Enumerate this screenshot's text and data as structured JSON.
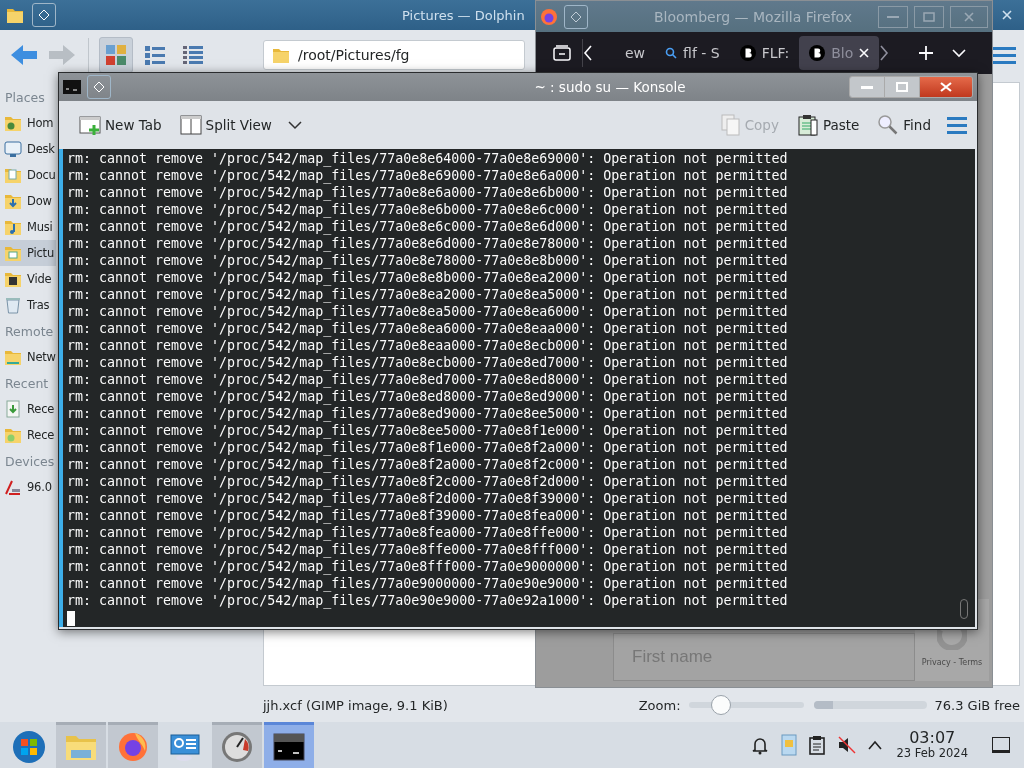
{
  "dolphin": {
    "title": "Pictures — Dolphin",
    "location": "/root/Pictures/fg",
    "view_modes": [
      {
        "kind": "icons",
        "selected": true
      },
      {
        "kind": "compact",
        "selected": false
      },
      {
        "kind": "details",
        "selected": false
      }
    ],
    "sidebar": [
      {
        "heading": "Places",
        "items": [
          {
            "kind": "home",
            "label": "Hom",
            "selected": false
          },
          {
            "kind": "desktop",
            "label": "Desk",
            "selected": false
          },
          {
            "kind": "documents",
            "label": "Docu",
            "selected": false
          },
          {
            "kind": "downloads",
            "label": "Dow",
            "selected": false
          },
          {
            "kind": "music",
            "label": "Musi",
            "selected": false
          },
          {
            "kind": "pictures",
            "label": "Pictu",
            "selected": true
          },
          {
            "kind": "videos",
            "label": "Vide",
            "selected": false
          },
          {
            "kind": "trash",
            "label": "Tras",
            "selected": false
          }
        ]
      },
      {
        "heading": "Remote",
        "items": [
          {
            "kind": "network",
            "label": "Netw",
            "selected": false
          }
        ]
      },
      {
        "heading": "Recent",
        "items": [
          {
            "kind": "recent-files",
            "label": "Rece",
            "selected": false
          },
          {
            "kind": "recent-locations",
            "label": "Rece",
            "selected": false
          }
        ]
      },
      {
        "heading": "Devices",
        "items": [
          {
            "kind": "device",
            "label": "96.0",
            "selected": false
          }
        ]
      }
    ],
    "status": "jjh.xcf (GIMP image, 9.1 KiB)",
    "zoom_label": "Zoom:",
    "zoom": {
      "level": 0.28
    },
    "free_space": {
      "level": 0.17,
      "reading": "76.3 GiB free"
    }
  },
  "firefox": {
    "title": "Bloomberg — Mozilla Firefox",
    "tabs": [
      {
        "kind": "plain",
        "label": "ew",
        "selected": false
      },
      {
        "kind": "search",
        "label": "flf - S",
        "selected": false
      },
      {
        "kind": "site",
        "label": "FLF:",
        "selected": false
      },
      {
        "kind": "site",
        "label": "Blo",
        "selected": true
      }
    ],
    "form_field": {
      "placeholder": "First name"
    },
    "captcha_text": "Privacy - Terms"
  },
  "konsole": {
    "title": "~ : sudo su — Konsole",
    "toolbar_left": [
      {
        "kind": "new-tab",
        "label": "New Tab",
        "disabled": false
      },
      {
        "kind": "split-view",
        "label": "Split View",
        "disabled": false
      }
    ],
    "toolbar_right": [
      {
        "kind": "copy",
        "label": "Copy",
        "disabled": true
      },
      {
        "kind": "paste",
        "label": "Paste",
        "disabled": false
      },
      {
        "kind": "find",
        "label": "Find",
        "disabled": false
      }
    ],
    "lines": [
      "rm: cannot remove '/proc/542/map_files/77a0e8e64000-77a0e8e69000': Operation not permitted",
      "rm: cannot remove '/proc/542/map_files/77a0e8e69000-77a0e8e6a000': Operation not permitted",
      "rm: cannot remove '/proc/542/map_files/77a0e8e6a000-77a0e8e6b000': Operation not permitted",
      "rm: cannot remove '/proc/542/map_files/77a0e8e6b000-77a0e8e6c000': Operation not permitted",
      "rm: cannot remove '/proc/542/map_files/77a0e8e6c000-77a0e8e6d000': Operation not permitted",
      "rm: cannot remove '/proc/542/map_files/77a0e8e6d000-77a0e8e78000': Operation not permitted",
      "rm: cannot remove '/proc/542/map_files/77a0e8e78000-77a0e8e8b000': Operation not permitted",
      "rm: cannot remove '/proc/542/map_files/77a0e8e8b000-77a0e8ea2000': Operation not permitted",
      "rm: cannot remove '/proc/542/map_files/77a0e8ea2000-77a0e8ea5000': Operation not permitted",
      "rm: cannot remove '/proc/542/map_files/77a0e8ea5000-77a0e8ea6000': Operation not permitted",
      "rm: cannot remove '/proc/542/map_files/77a0e8ea6000-77a0e8eaa000': Operation not permitted",
      "rm: cannot remove '/proc/542/map_files/77a0e8eaa000-77a0e8ecb000': Operation not permitted",
      "rm: cannot remove '/proc/542/map_files/77a0e8ecb000-77a0e8ed7000': Operation not permitted",
      "rm: cannot remove '/proc/542/map_files/77a0e8ed7000-77a0e8ed8000': Operation not permitted",
      "rm: cannot remove '/proc/542/map_files/77a0e8ed8000-77a0e8ed9000': Operation not permitted",
      "rm: cannot remove '/proc/542/map_files/77a0e8ed9000-77a0e8ee5000': Operation not permitted",
      "rm: cannot remove '/proc/542/map_files/77a0e8ee5000-77a0e8f1e000': Operation not permitted",
      "rm: cannot remove '/proc/542/map_files/77a0e8f1e000-77a0e8f2a000': Operation not permitted",
      "rm: cannot remove '/proc/542/map_files/77a0e8f2a000-77a0e8f2c000': Operation not permitted",
      "rm: cannot remove '/proc/542/map_files/77a0e8f2c000-77a0e8f2d000': Operation not permitted",
      "rm: cannot remove '/proc/542/map_files/77a0e8f2d000-77a0e8f39000': Operation not permitted",
      "rm: cannot remove '/proc/542/map_files/77a0e8f39000-77a0e8fea000': Operation not permitted",
      "rm: cannot remove '/proc/542/map_files/77a0e8fea000-77a0e8ffe000': Operation not permitted",
      "rm: cannot remove '/proc/542/map_files/77a0e8ffe000-77a0e8fff000': Operation not permitted",
      "rm: cannot remove '/proc/542/map_files/77a0e8fff000-77a0e9000000': Operation not permitted",
      "rm: cannot remove '/proc/542/map_files/77a0e9000000-77a0e90e9000': Operation not permitted",
      "rm: cannot remove '/proc/542/map_files/77a0e90e9000-77a0e92a1000': Operation not permitted"
    ]
  },
  "taskbar": {
    "apps": [
      {
        "kind": "start",
        "running": false,
        "selected": false
      },
      {
        "kind": "files",
        "running": true,
        "selected": false
      },
      {
        "kind": "browser",
        "running": true,
        "selected": false
      },
      {
        "kind": "settings",
        "running": false,
        "selected": false
      },
      {
        "kind": "gauge",
        "running": true,
        "selected": false
      },
      {
        "kind": "terminal",
        "running": true,
        "selected": true
      }
    ],
    "tray": [
      {
        "kind": "bell"
      },
      {
        "kind": "image"
      },
      {
        "kind": "clipboard"
      },
      {
        "kind": "muted"
      },
      {
        "kind": "expand"
      }
    ],
    "clock": {
      "time": "03:07",
      "date": "23 Feb 2024"
    }
  }
}
